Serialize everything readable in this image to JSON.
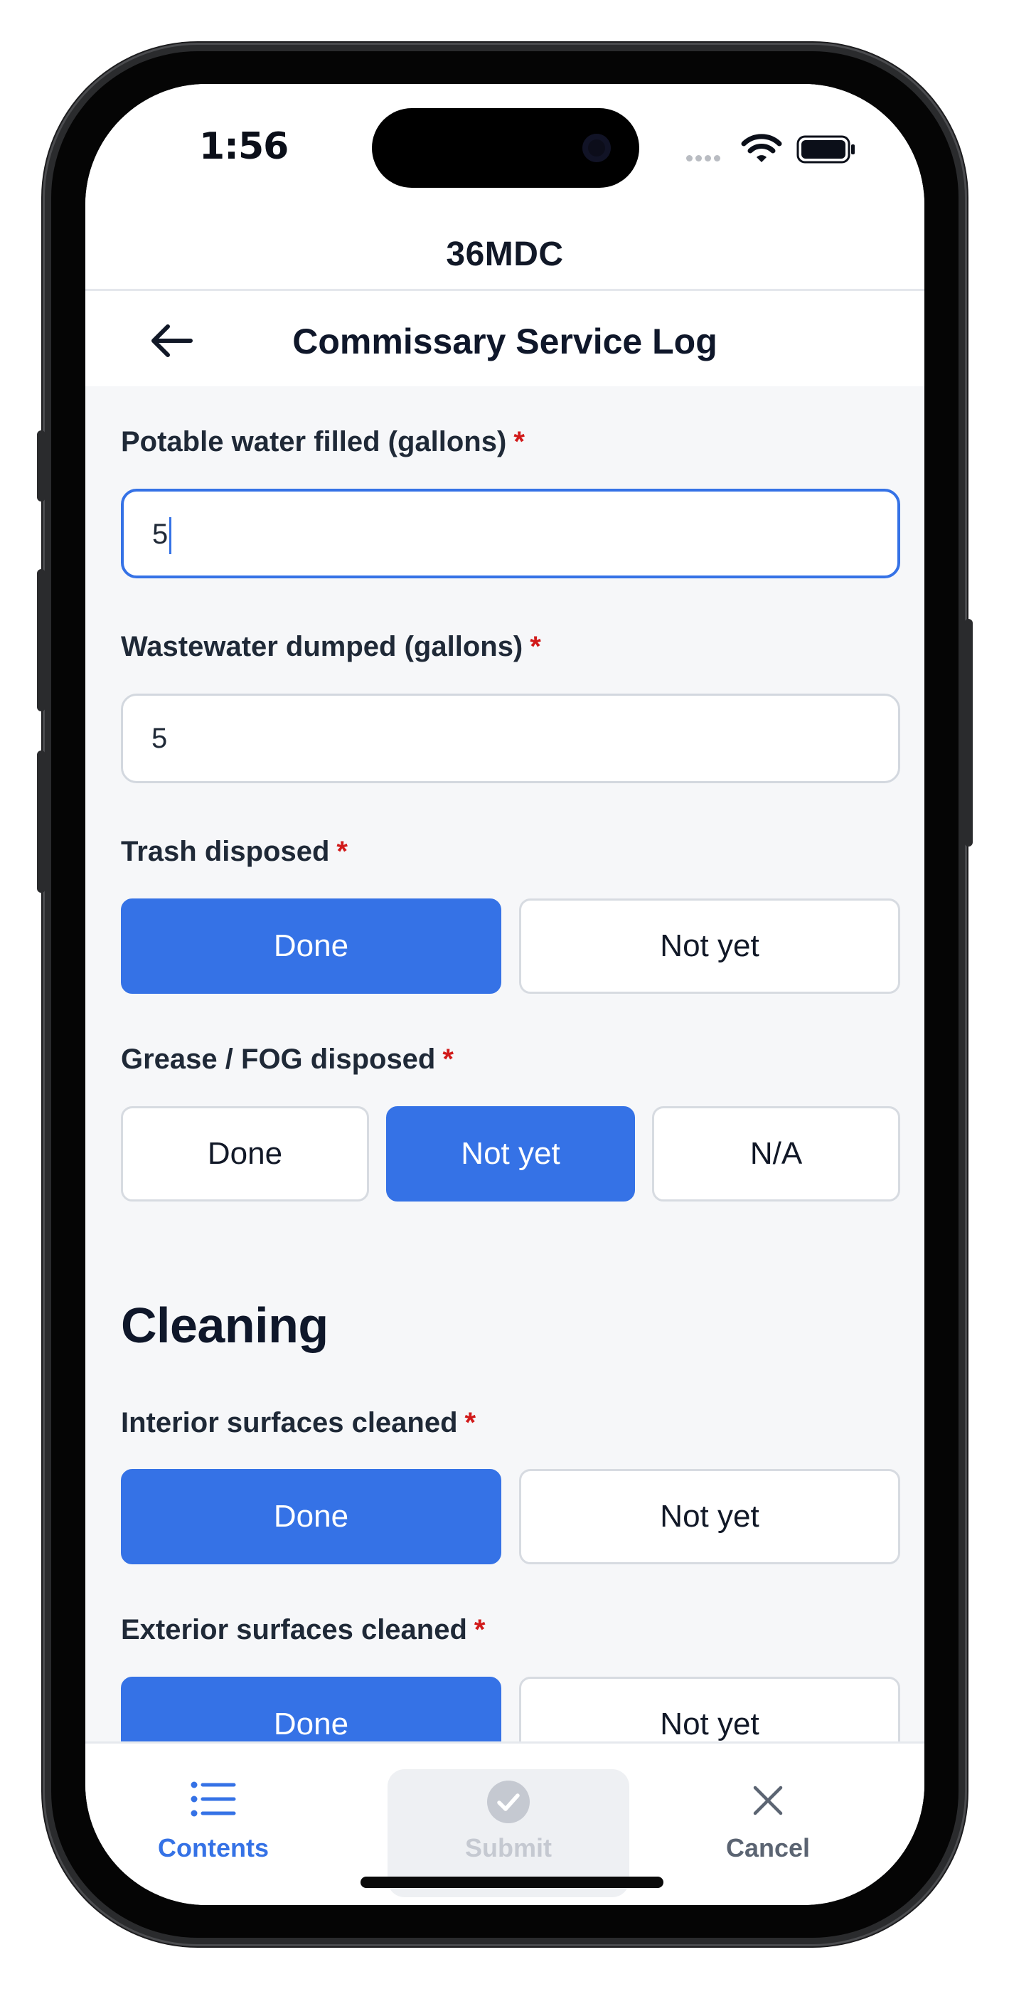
{
  "status": {
    "time": "1:56"
  },
  "app": {
    "name": "36MDC"
  },
  "nav": {
    "title": "Commissary Service Log"
  },
  "form": {
    "potable_label": "Potable water filled (gallons)",
    "potable_value": "5",
    "waste_label": "Wastewater dumped (gallons)",
    "waste_value": "5",
    "trash_label": "Trash disposed",
    "trash_options": [
      "Done",
      "Not yet"
    ],
    "trash_selected": "Done",
    "grease_label": "Grease / FOG disposed",
    "grease_options": [
      "Done",
      "Not yet",
      "N/A"
    ],
    "grease_selected": "Not yet",
    "required_mark": "*"
  },
  "cleaning": {
    "title": "Cleaning",
    "interior_label": "Interior surfaces cleaned",
    "interior_options": [
      "Done",
      "Not yet"
    ],
    "interior_selected": "Done",
    "exterior_label": "Exterior surfaces cleaned",
    "exterior_options": [
      "Done",
      "Not yet"
    ],
    "exterior_selected": "Done"
  },
  "bottom": {
    "contents": "Contents",
    "submit": "Submit",
    "cancel": "Cancel"
  },
  "colors": {
    "accent": "#3572e6",
    "required": "#d11a1a",
    "disabled": "#c5c9d1",
    "cancel": "#5b6472"
  },
  "icons": {
    "contents": "list-icon",
    "submit": "check-circle-icon",
    "cancel": "close-icon",
    "back": "arrow-left-icon"
  }
}
